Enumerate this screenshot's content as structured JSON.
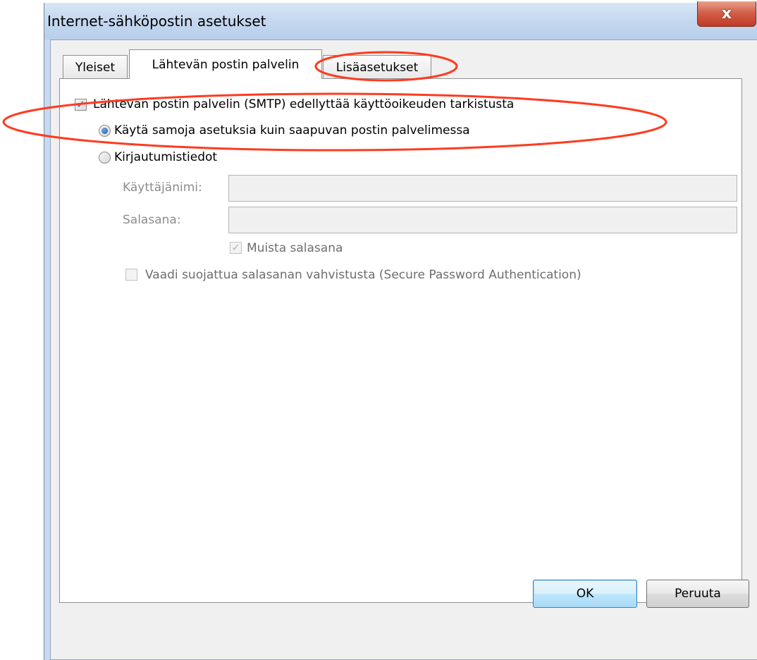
{
  "window": {
    "title": "Internet-sähköpostin asetukset",
    "close_label": "x"
  },
  "tabs": [
    {
      "label": "Yleiset",
      "active": false
    },
    {
      "label": "Lähtevän postin palvelin",
      "active": true
    },
    {
      "label": "Lisäasetukset",
      "active": false
    }
  ],
  "outgoing": {
    "smtp_auth_checkbox": {
      "label": "Lähtevän postin palvelin (SMTP) edellyttää käyttöoikeuden tarkistusta",
      "checked": true
    },
    "radio_same_settings": {
      "label": "Käytä samoja asetuksia kuin saapuvan postin palvelimessa",
      "selected": true
    },
    "radio_login": {
      "label": "Kirjautumistiedot",
      "selected": false
    },
    "username": {
      "label": "Käyttäjänimi:",
      "value": ""
    },
    "password": {
      "label": "Salasana:",
      "value": ""
    },
    "remember_password": {
      "label": "Muista salasana",
      "checked": true,
      "disabled": true
    },
    "spa": {
      "label": "Vaadi suojattua salasanan vahvistusta (Secure Password Authentication)",
      "checked": false,
      "disabled": true
    }
  },
  "buttons": {
    "ok": "OK",
    "cancel": "Peruuta"
  },
  "colors": {
    "annotation": "#ff3b1f",
    "radio_selected": "#1f5aa6"
  }
}
